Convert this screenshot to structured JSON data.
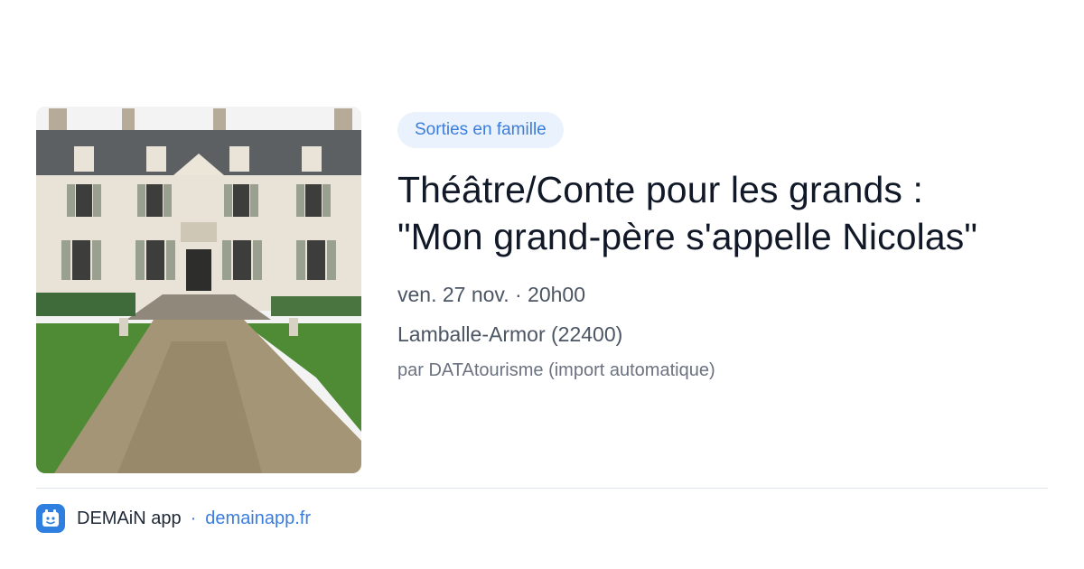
{
  "event": {
    "image_alt": "castle-with-driveway",
    "category": "Sorties en famille",
    "title_line1": "Théâtre/Conte pour les grands :",
    "title_line2": "\"Mon grand-père s'appelle Nicolas\"",
    "date_time": "ven. 27 nov. · 20h00",
    "location": "Lamballe-Armor (22400)",
    "source": "par DATAtourisme (import automatique)"
  },
  "footer": {
    "app_name": "DEMAiN app",
    "separator": "·",
    "domain": "demainapp.fr",
    "app_icon": "demain-app-icon"
  },
  "colors": {
    "accent": "#3b7ddd",
    "badge_bg": "#eaf2fd",
    "title": "#111827",
    "meta": "#4b5563",
    "muted": "#6b7280",
    "divider": "#dfe5ea",
    "app_icon_bg": "#2f7fe0"
  }
}
